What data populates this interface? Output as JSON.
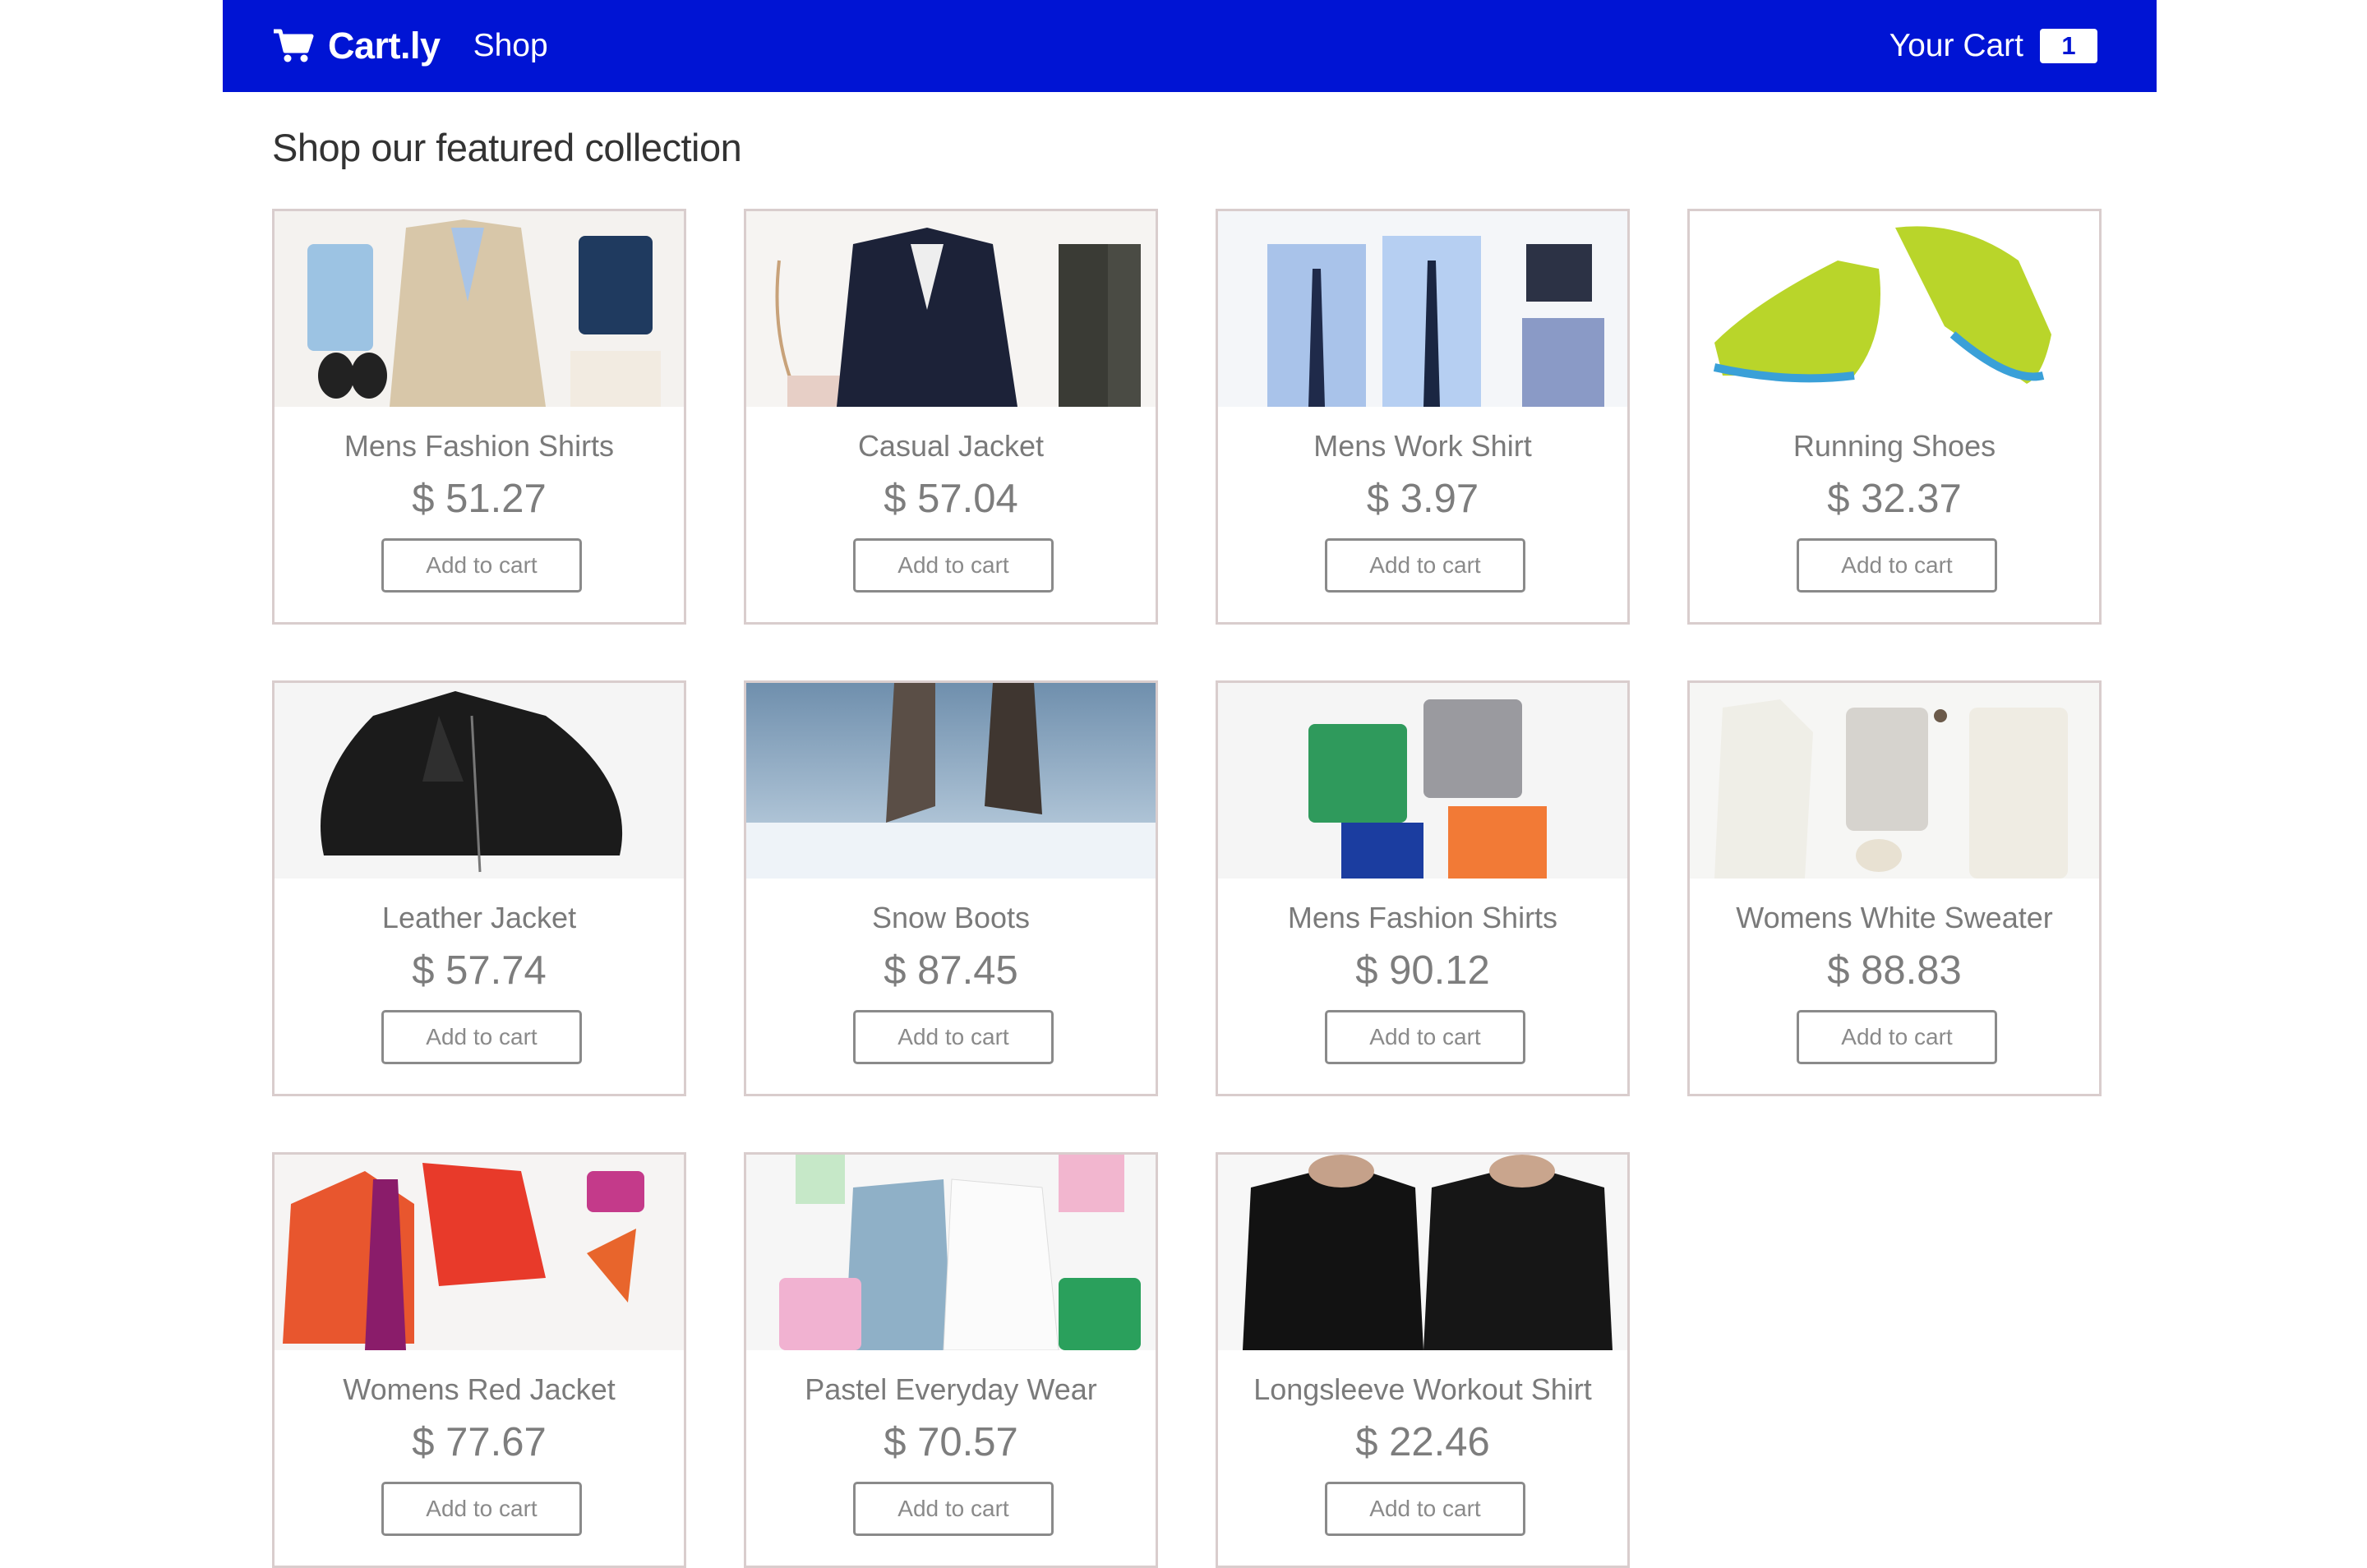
{
  "navbar": {
    "brand": "Cart.ly",
    "brand_icon": "shopping-cart-icon",
    "shop_link": "Shop",
    "cart_label": "Your Cart",
    "cart_count": "1",
    "bg_color": "#0014d4"
  },
  "page": {
    "title": "Shop our featured collection"
  },
  "add_label": "Add to cart",
  "products": [
    {
      "name": "Mens Fashion Shirts",
      "price": "$ 51.27",
      "image": "flatlay-jacket-shirts-shoes"
    },
    {
      "name": "Casual Jacket",
      "price": "$ 57.04",
      "image": "navy-jacket-outfit"
    },
    {
      "name": "Mens Work Shirt",
      "price": "$ 3.97",
      "image": "dress-shirts-ties"
    },
    {
      "name": "Running Shoes",
      "price": "$ 32.37",
      "image": "lime-sneakers"
    },
    {
      "name": "Leather Jacket",
      "price": "$ 57.74",
      "image": "black-leather-jacket"
    },
    {
      "name": "Snow Boots",
      "price": "$ 87.45",
      "image": "boots-in-snow"
    },
    {
      "name": "Mens Fashion Shirts",
      "price": "$ 90.12",
      "image": "folded-polo-shirts"
    },
    {
      "name": "Womens White Sweater",
      "price": "$ 88.83",
      "image": "white-outfit-flatlay"
    },
    {
      "name": "Womens Red Jacket",
      "price": "$ 77.67",
      "image": "red-jacket-heels"
    },
    {
      "name": "Pastel Everyday Wear",
      "price": "$ 70.57",
      "image": "pastel-shirts-flatlay"
    },
    {
      "name": "Longsleeve Workout Shirt",
      "price": "$ 22.46",
      "image": "black-longsleeve-shirts"
    }
  ]
}
